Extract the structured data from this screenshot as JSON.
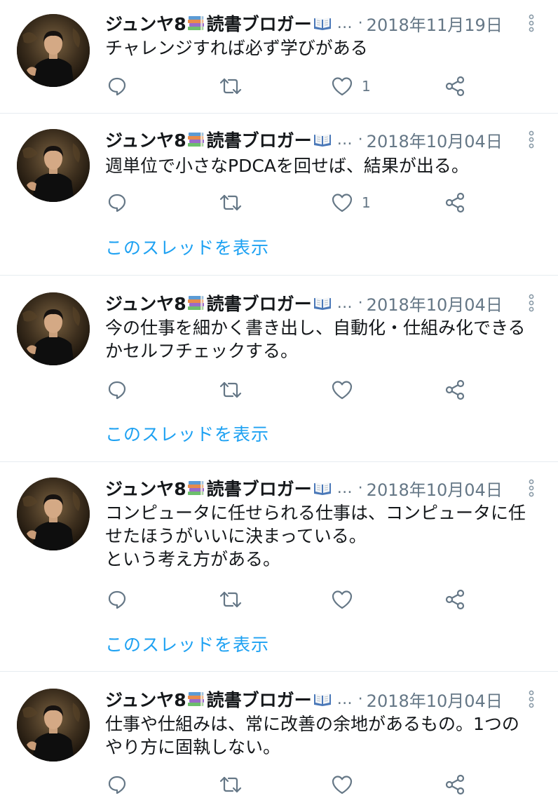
{
  "colors": {
    "text": "#14171a",
    "secondary": "#657786",
    "link": "#1da1f2",
    "divider": "#e6ecf0",
    "icon": "#657786"
  },
  "icons": {
    "books": "books-emoji-icon",
    "open_book": "open-book-emoji-icon",
    "reply": "reply-icon",
    "retweet": "retweet-icon",
    "like": "heart-icon",
    "share": "share-icon",
    "more": "more-vertical-icon"
  },
  "tweets": [
    {
      "name": "ジュンヤ8",
      "truncation": "…",
      "separator": "·",
      "date": "2018年11月19日",
      "lines": [
        "チャレンジすれば必ず学びがある"
      ],
      "like_count": "1",
      "thread_link": ""
    },
    {
      "name": "ジュンヤ8",
      "truncation": "…",
      "separator": "·",
      "date": "2018年10月04日",
      "lines": [
        "週単位で小さなPDCAを回せば、結果が出る。"
      ],
      "like_count": "1",
      "thread_link": "このスレッドを表示"
    },
    {
      "name": "ジュンヤ8",
      "truncation": "…",
      "separator": "·",
      "date": "2018年10月04日",
      "lines": [
        "今の仕事を細かく書き出し、自動化・仕組み化できる",
        "かセルフチェックする。"
      ],
      "like_count": "",
      "thread_link": "このスレッドを表示"
    },
    {
      "name": "ジュンヤ8",
      "truncation": "…",
      "separator": "·",
      "date": "2018年10月04日",
      "lines": [
        "コンピュータに任せられる仕事は、コンピュータに任",
        "せたほうがいいに決まっている。",
        "という考え方がある。"
      ],
      "like_count": "",
      "thread_link": "このスレッドを表示"
    },
    {
      "name": "ジュンヤ8",
      "truncation": "…",
      "separator": "·",
      "date": "2018年10月04日",
      "lines": [
        "仕事や仕組みは、常に改善の余地があるもの。1つの",
        "やり方に固執しない。"
      ],
      "like_count": "",
      "thread_link": ""
    }
  ]
}
